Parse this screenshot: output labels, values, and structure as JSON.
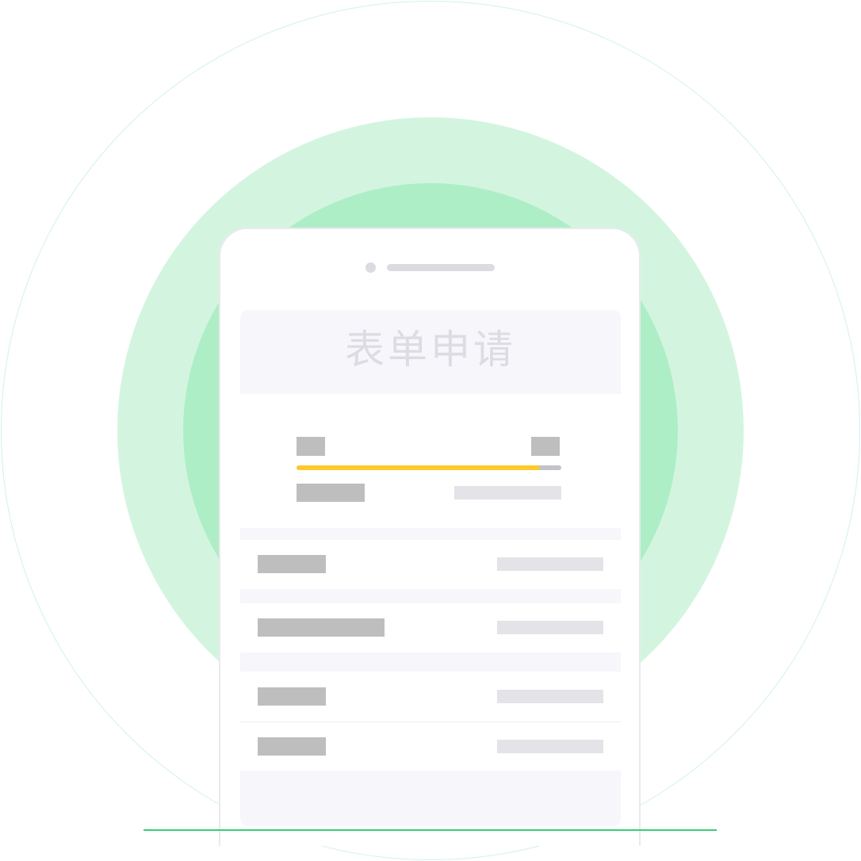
{
  "colors": {
    "outer_ring": "#d3f0f0",
    "mid_disc": "#d3f5e0",
    "inner_disc": "#aeeec6",
    "progress_fill": "#fdc92d",
    "ground_line": "#3dcc75",
    "placeholder_dark": "#bebebe",
    "placeholder_light": "#e3e3e8",
    "band": "#f6f6fb"
  },
  "phone": {
    "title": "表单申请",
    "progress": {
      "fraction": 0.92
    }
  },
  "icons": {
    "camera": "camera-dot-icon",
    "speaker": "speaker-bar-icon"
  }
}
